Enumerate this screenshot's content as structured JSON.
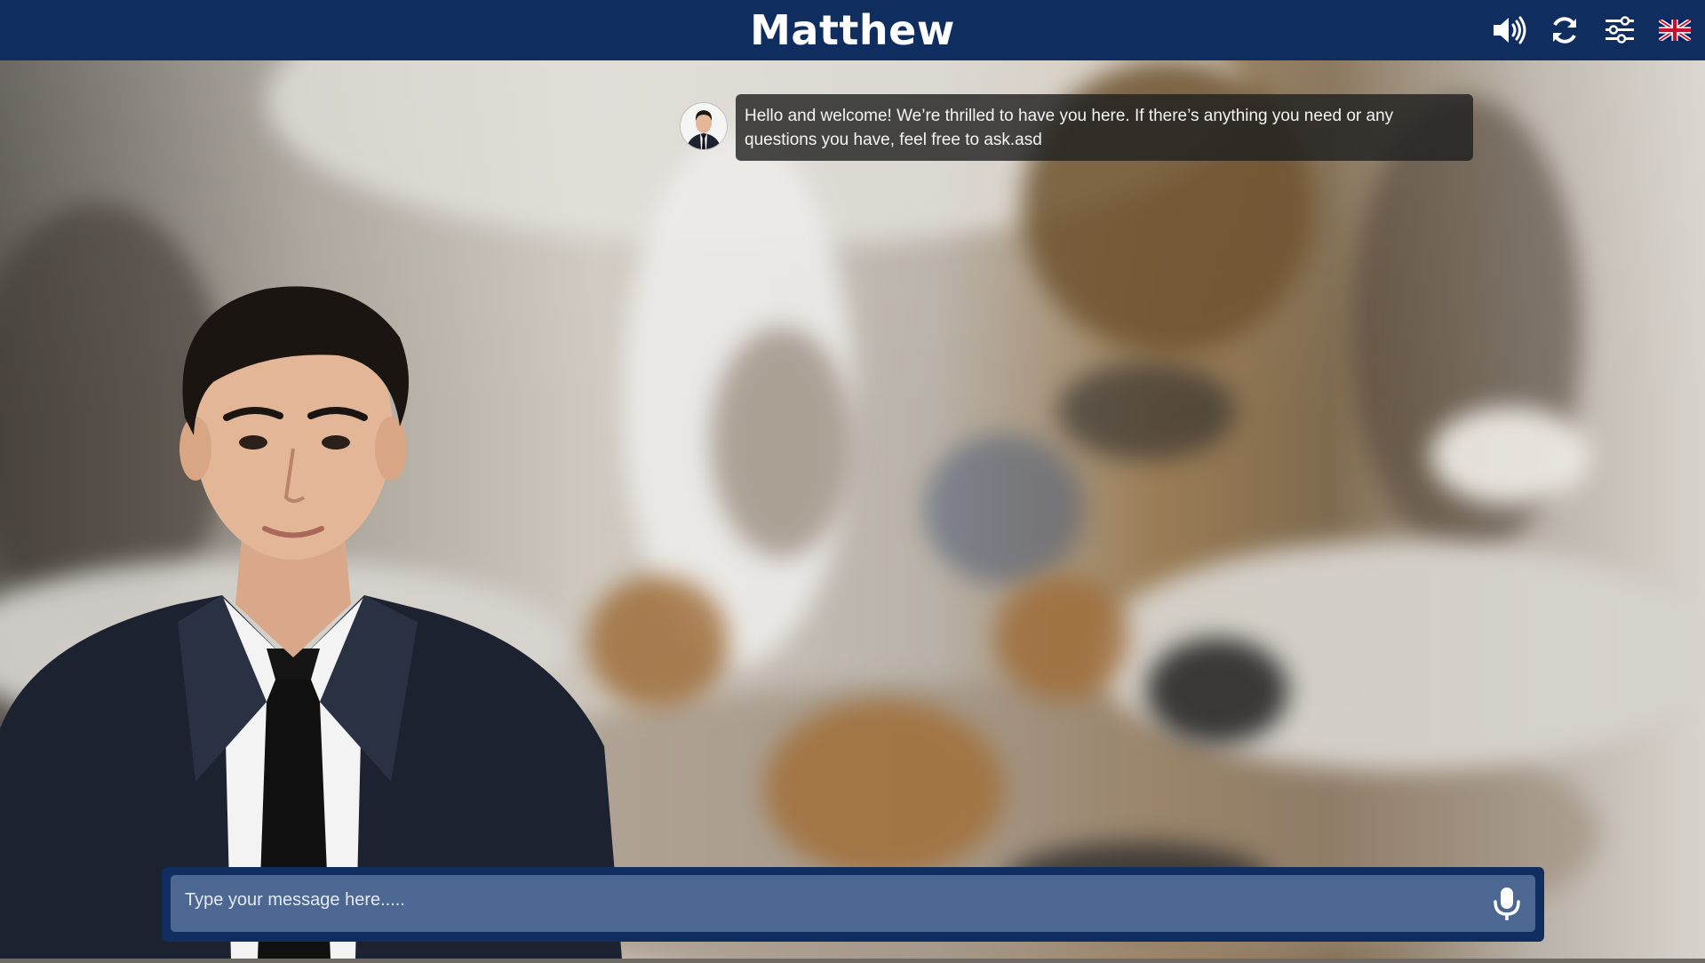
{
  "header": {
    "title": "Matthew",
    "icons": [
      "speaker-icon",
      "refresh-icon",
      "settings-sliders-icon",
      "uk-flag-icon"
    ]
  },
  "chat": {
    "messages": [
      {
        "sender": "bot",
        "text": "Hello and welcome! We’re thrilled to have you here. If there’s anything you need or any questions you have, feel free to ask.asd"
      }
    ]
  },
  "input": {
    "placeholder": "Type your message here.....",
    "value": ""
  },
  "colors": {
    "header_bg": "#0f2d5e",
    "input_inner_bg": "#4c6791",
    "bubble_bg": "#1e1e1e"
  }
}
